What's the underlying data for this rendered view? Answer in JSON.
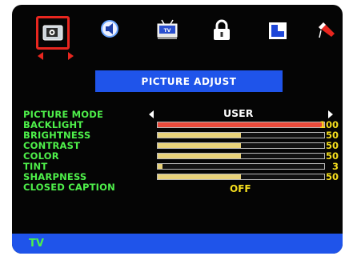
{
  "menu": {
    "icons": [
      {
        "name": "picture-icon",
        "selected": true
      },
      {
        "name": "audio-icon",
        "selected": false
      },
      {
        "name": "tv-icon",
        "selected": false
      },
      {
        "name": "lock-icon",
        "selected": false
      },
      {
        "name": "display-icon",
        "selected": false
      },
      {
        "name": "setup-icon",
        "selected": false
      }
    ]
  },
  "title": "PICTURE ADJUST",
  "settings": {
    "picture_mode": {
      "label": "PICTURE MODE",
      "value": "USER"
    },
    "backlight": {
      "label": "BACKLIGHT",
      "value": "100",
      "level": 100
    },
    "brightness": {
      "label": "BRIGHTNESS",
      "value": "50",
      "level": 50
    },
    "contrast": {
      "label": "CONTRAST",
      "value": "50",
      "level": 50
    },
    "color": {
      "label": "COLOR",
      "value": "50",
      "level": 50
    },
    "tint": {
      "label": "TINT",
      "value": "3",
      "level": 3
    },
    "sharpness": {
      "label": "SHARPNESS",
      "value": "50",
      "level": 50
    },
    "closed_caption": {
      "label": "CLOSED CAPTION",
      "value": "OFF"
    }
  },
  "footer": {
    "label": "TV"
  },
  "colors": {
    "background": "#050505",
    "accent_blue": "#1f54ea",
    "label_green": "#4ef04a",
    "value_yellow": "#f6df1e",
    "selection_red": "#e8261f"
  }
}
